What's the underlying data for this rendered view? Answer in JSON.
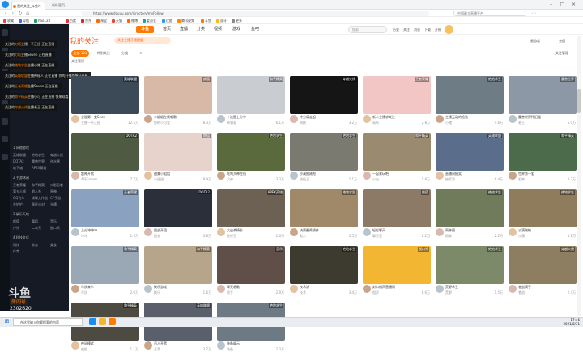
{
  "browser": {
    "tabs": [
      {
        "label": "我的关注_斗鱼",
        "active": true
      },
      {
        "label": "新标签页",
        "active": false
      }
    ],
    "url": "https://www.douyu.com/directory/myFollow",
    "url_prefix": "https://www.douyu.com",
    "search_placeholder": "中国最大直播平台",
    "bookmarks": [
      "收藏",
      "导航",
      "hao123",
      "百度",
      "京东",
      "淘宝",
      "天猫",
      "微博",
      "爱奇艺",
      "优酷",
      "腾讯视频",
      "斗鱼",
      "虎牙",
      "更多"
    ],
    "bookmark_colors": [
      "#e44",
      "#2a7ae2",
      "#1aa260",
      "#e33",
      "#d22",
      "#ff6a00",
      "#e43",
      "#f60",
      "#1a9",
      "#29f",
      "#f80",
      "#f70",
      "#fb0",
      "#888"
    ]
  },
  "header": {
    "logo": "斗鱼",
    "nav": [
      "首页",
      "直播",
      "分类",
      "视频",
      "游戏",
      "鱼吧"
    ],
    "search_placeholder": "搜索",
    "icons": [
      "历史",
      "关注",
      "消息",
      "下载",
      "开播"
    ],
    "follow_mgr": "关注管理",
    "right_links": [
      "云游戏",
      "充值"
    ]
  },
  "sidebar": {
    "tooltips": [
      {
        "prefix": "关注的",
        "highlight": "刀塔",
        "text": "主播一不正经 正在直播"
      },
      {
        "prefix": "关注的",
        "highlight": "刀塔",
        "text": "主播Seven 正在直播"
      },
      {
        "prefix": "关注的",
        "highlight": "绝地求生",
        "text": "主播小猪 正在直播"
      },
      {
        "prefix": "关注的",
        "highlight": "英雄联盟",
        "text": "主播神秘人 正在直播 你的开播提醒已开启"
      },
      {
        "prefix": "关注的",
        "highlight": "王者荣耀",
        "text": "主播Seven 正在直播"
      },
      {
        "prefix": "关注的",
        "highlight": "和平精英",
        "text": "主播小可 正在直播 快来观看吧"
      },
      {
        "prefix": "关注的",
        "highlight": "穿越火线",
        "text": "主播老王 正在直播"
      }
    ],
    "sections": [
      {
        "title": "1 网络游戏",
        "items": [
          "英雄联盟",
          "绝地求生",
          "穿越火线",
          "DOTA2",
          "魔兽世界",
          "逆水寒",
          "地下城",
          "APEX英雄"
        ]
      },
      {
        "title": "2 手游休闲",
        "items": [
          "王者荣耀",
          "和平精英",
          "火影忍者",
          "第五人格",
          "狼人杀",
          "原神",
          "QQ飞车",
          "球球大作战",
          "CF手游",
          "金铲铲",
          "蛋仔派对",
          "光遇"
        ]
      },
      {
        "title": "3 娱乐天地",
        "items": [
          "颜值",
          "舞蹈",
          "音乐",
          "户外",
          "二次元",
          "脱口秀"
        ]
      },
      {
        "title": "4 科技文化",
        "items": [
          "科技",
          "教育",
          "美食",
          "体育"
        ]
      }
    ],
    "watermark": "斗鱼",
    "watermark_sub": "房间号",
    "watermark_num": "2302620"
  },
  "main": {
    "title": "我的关注",
    "promo": "关注主播开播提醒",
    "tabs": [
      "全部 101",
      "特别关注",
      "分组"
    ],
    "cards": [
      {
        "title": "全服第一女Seek",
        "name": "主播一不正经",
        "hot": "12.5万",
        "cat": "英雄联盟",
        "bg": "#3c4a58"
      },
      {
        "title": "小姐姐在线唱歌",
        "name": "你的小可爱",
        "hot": "8.3万",
        "cat": "颜值",
        "bg": "#d8b9a8"
      },
      {
        "title": "十连胜上分中",
        "name": "Hi狼叔",
        "hot": "6.1万",
        "cat": "和平精英",
        "bg": "#c9ccd1"
      },
      {
        "title": "冲分局走起",
        "name": "刷刷",
        "hot": "3.2万",
        "cat": "穿越火线",
        "bg": "#151515"
      },
      {
        "title": "新人主播求关注",
        "name": "萌新",
        "hot": "2.8万",
        "cat": "王者荣耀",
        "bg": "#f2c6c4"
      },
      {
        "title": "主播无敌的枪法",
        "name": "小猪",
        "hot": "4.6万",
        "cat": "绝地求生",
        "bg": "#6e7c86"
      },
      {
        "title": "魔兽世界怀旧服",
        "name": "老王",
        "hot": "5.0万",
        "cat": "魔兽世界",
        "bg": "#8d98a6"
      },
      {
        "title": "超神开黑",
        "name": "4阿Gamer",
        "hot": "7.7万",
        "cat": "DOTA2",
        "bg": "#4e5a42"
      },
      {
        "title": "甜美小姐姐",
        "name": "小甜甜",
        "hot": "9.9万",
        "cat": "颜值",
        "bg": "#e7d3cc"
      },
      {
        "title": "吃鸡大神在线",
        "name": "大神",
        "hot": "3.3万",
        "cat": "绝地求生",
        "bg": "#5b6a3d"
      },
      {
        "title": "沙漠图刚枪",
        "name": "刚枪王",
        "hot": "2.1万",
        "cat": "绝地求生",
        "bg": "#7a7a70"
      },
      {
        "title": "一起来玩吧",
        "name": "小白",
        "hot": "1.8万",
        "cat": "和平精英",
        "bg": "#9a8a70"
      },
      {
        "title": "直播间抽奖",
        "name": "抽奖哥",
        "hot": "6.4万",
        "cat": "英雄联盟",
        "bg": "#5a6d8a"
      },
      {
        "title": "世界第一狙",
        "name": "狙神",
        "hot": "4.2万",
        "cat": "和平精英",
        "bg": "#4b6b4a"
      },
      {
        "title": "上分冲冲冲",
        "name": "冲冲",
        "hot": "1.9万",
        "cat": "王者荣耀",
        "bg": "#8aa2c0"
      },
      {
        "title": "团战开团",
        "name": "团长",
        "hot": "3.8万",
        "cat": "DOTA2",
        "bg": "#2b2f3a"
      },
      {
        "title": "大逃杀精彩",
        "name": "逃杀王",
        "hot": "2.6万",
        "cat": "APEX英雄",
        "bg": "#6c6152"
      },
      {
        "title": "决赛圈秀操作",
        "name": "老六",
        "hot": "5.5万",
        "cat": "绝地求生",
        "bg": "#a08968"
      },
      {
        "title": "轻松聊天",
        "name": "聊天室",
        "hot": "1.2万",
        "cat": "颜值",
        "bg": "#8c7a66"
      },
      {
        "title": "雨林图",
        "name": "雨林",
        "hot": "2.2万",
        "cat": "绝地求生",
        "bg": "#6f7b5a"
      },
      {
        "title": "沙漠刚枪",
        "name": "沙漠",
        "hot": "3.1万",
        "cat": "绝地求生",
        "bg": "#8f7c5d"
      },
      {
        "title": "车队来人",
        "name": "车队",
        "hot": "2.0万",
        "cat": "和平精英",
        "bg": "#9aa7b4"
      },
      {
        "title": "快乐游戏",
        "name": "快乐",
        "hot": "1.6万",
        "cat": "和平精英",
        "bg": "#b6a58a"
      },
      {
        "title": "聊天唱歌",
        "name": "歌手",
        "hot": "2.9万",
        "cat": "音乐",
        "bg": "#5f4f48"
      },
      {
        "title": "技术流",
        "name": "技术",
        "hot": "3.4万",
        "cat": "绝地求生",
        "bg": "#3d3a30"
      },
      {
        "title": "封口相声直播间",
        "name": "相声",
        "hot": "6.6万",
        "cat": "脱口秀",
        "bg": "#f2b632"
      },
      {
        "title": "荒野求生",
        "name": "荒野",
        "hot": "1.5万",
        "cat": "绝地求生",
        "bg": "#7d8a6a"
      },
      {
        "title": "巷战高手",
        "name": "巷战",
        "hot": "2.4万",
        "cat": "穿越火线",
        "bg": "#8d7e62"
      },
      {
        "title": "夜间模式",
        "name": "夜猫",
        "hot": "1.1万",
        "cat": "和平精英",
        "bg": "#4d4a42"
      },
      {
        "title": "百人开黑",
        "name": "开黑",
        "hot": "3.7万",
        "cat": "英雄联盟",
        "bg": "#5a5f6c"
      },
      {
        "title": "装备展示",
        "name": "装备",
        "hot": "2.3万",
        "cat": "绝地求生",
        "bg": "#6d7a84"
      }
    ]
  },
  "taskbar": {
    "search_placeholder": "在这里输入你要搜索的内容",
    "time": "17:46",
    "date": "2021/8/31"
  }
}
